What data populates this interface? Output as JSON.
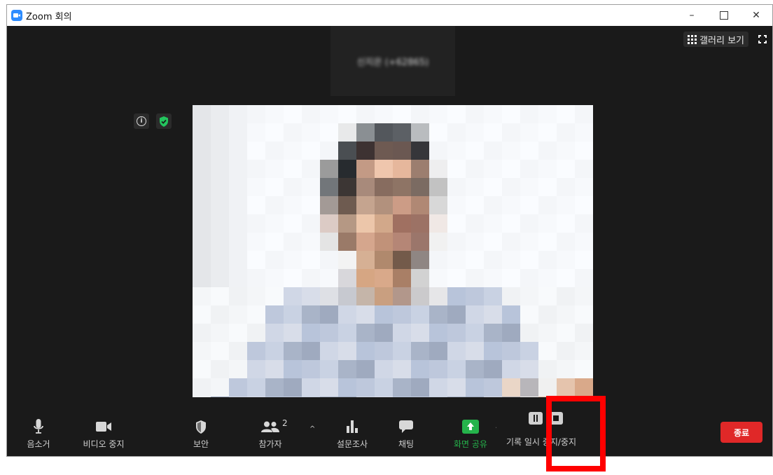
{
  "window": {
    "title": "Zoom 회의",
    "minimize_glyph": "–",
    "close_glyph": "✕"
  },
  "top_right": {
    "gallery_label": "갤러리 보기"
  },
  "speaker": {
    "name": "신지은 (+62865)"
  },
  "toolbar": {
    "mute_label": "음소거",
    "stop_video_label": "비디오 중지",
    "security_label": "보안",
    "participants_label": "참가자",
    "participants_count": "2",
    "polls_label": "설문조사",
    "chat_label": "채팅",
    "share_label": "화면 공유",
    "recording_label": "기록 일시 중지/중지",
    "end_label": "종료",
    "caret_glyph": "^"
  },
  "colors": {
    "accent_blue": "#2d8cff",
    "share_green": "#25b34b",
    "end_red": "#e02828",
    "highlight_red": "#ff0000"
  },
  "icons": [
    "app-icon",
    "gallery-icon",
    "fullscreen-icon",
    "info-icon",
    "shield-check-icon",
    "microphone-icon",
    "video-camera-icon",
    "security-shield-icon",
    "participants-icon",
    "polls-icon",
    "chat-icon",
    "share-arrow-icon",
    "pause-icon",
    "stop-icon"
  ]
}
